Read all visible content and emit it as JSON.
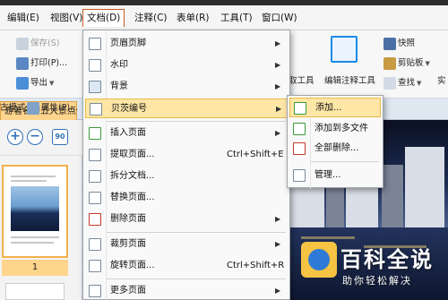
{
  "menubar": {
    "items": [
      "编辑(E)",
      "视图(V)",
      "文档(D)",
      "注释(C)",
      "表单(R)",
      "工具(T)",
      "窗口(W)"
    ],
    "active": "文档(D)"
  },
  "ribbon": {
    "save": "保存(S)",
    "print": "打印(P)...",
    "export": "导出",
    "mode": "古模式",
    "properties": "属性(P)...",
    "tool_fragment": "取工具",
    "edit_annot": "编辑注释工具",
    "snapshot": "快照",
    "clipboard": "剪贴板",
    "find": "查找",
    "expand_fragment": "实"
  },
  "doc_tab": {
    "title": "游著名的五大景点"
  },
  "thumbnails": {
    "page_number": "1"
  },
  "zoom": {
    "in": "+",
    "out": "−",
    "rotate": "90"
  },
  "document_menu": {
    "items": [
      {
        "label": "页眉页脚",
        "submenu": true
      },
      {
        "label": "水印",
        "submenu": true
      },
      {
        "label": "背景",
        "submenu": true
      },
      {
        "label": "贝茨编号",
        "submenu": true
      },
      {
        "label": "插入页面",
        "submenu": true
      },
      {
        "label": "提取页面...",
        "shortcut": "Ctrl+Shift+E"
      },
      {
        "label": "拆分文档..."
      },
      {
        "label": "替换页面..."
      },
      {
        "label": "删除页面",
        "submenu": true
      },
      {
        "label": "裁剪页面",
        "submenu": true
      },
      {
        "label": "旋转页面...",
        "shortcut": "Ctrl+Shift+R"
      },
      {
        "label": "更多页面",
        "submenu": true
      }
    ]
  },
  "bates_submenu": {
    "items": [
      "添加...",
      "添加到多文件",
      "全部删除...",
      "管理..."
    ]
  },
  "watermark": {
    "title": "百科全说",
    "subtitle": "助你轻松解决"
  },
  "colors": {
    "highlight": "#fde6a6",
    "tab_accent": "#ffd48c",
    "brand_blue": "#2f6fb6"
  }
}
